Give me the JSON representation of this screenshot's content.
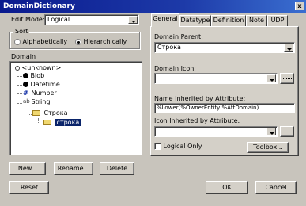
{
  "window": {
    "title": "DomainDictionary",
    "close_glyph": "x"
  },
  "edit_mode": {
    "label": "Edit Mode:",
    "value": "Logical"
  },
  "sort": {
    "label": "Sort",
    "options": [
      {
        "label": "Alphabetically",
        "selected": false
      },
      {
        "label": "Hierarchically",
        "selected": true
      }
    ]
  },
  "domain_tree": {
    "label": "Domain",
    "items": [
      {
        "label": "<unknown>",
        "icon": "unknown-icon",
        "level": 0
      },
      {
        "label": "Blob",
        "icon": "blob-icon",
        "level": 1
      },
      {
        "label": "Datetime",
        "icon": "datetime-icon",
        "level": 1
      },
      {
        "label": "Number",
        "icon": "number-icon",
        "level": 1
      },
      {
        "label": "String",
        "icon": "string-icon",
        "level": 1
      },
      {
        "label": "Строка",
        "icon": "folder-icon",
        "level": 2
      },
      {
        "label": "строка",
        "icon": "folder-icon",
        "level": 3,
        "selected": true
      }
    ]
  },
  "buttons": {
    "new": "New...",
    "rename": "Rename...",
    "delete": "Delete",
    "reset": "Reset",
    "ok": "OK",
    "cancel": "Cancel"
  },
  "tabs": [
    {
      "label": "General",
      "active": true
    },
    {
      "label": "Datatype",
      "active": false
    },
    {
      "label": "Definition",
      "active": false
    },
    {
      "label": "Note",
      "active": false
    },
    {
      "label": "UDP",
      "active": false
    }
  ],
  "general": {
    "domain_parent_label": "Domain Parent:",
    "domain_parent_value": "Строка",
    "domain_icon_label": "Domain Icon:",
    "domain_icon_value": "",
    "name_inherited_label": "Name Inherited by Attribute:",
    "name_inherited_value": "%Lower(%OwnerEntity %AttDomain)",
    "icon_inherited_label": "Icon Inherited by Attribute:",
    "icon_inherited_value": "",
    "logical_only_label": "Logical Only",
    "logical_only_checked": false,
    "toolbox_label": "Toolbox..."
  },
  "colors": {
    "selection": "#0a246a",
    "title_start": "#0a1a8e"
  }
}
